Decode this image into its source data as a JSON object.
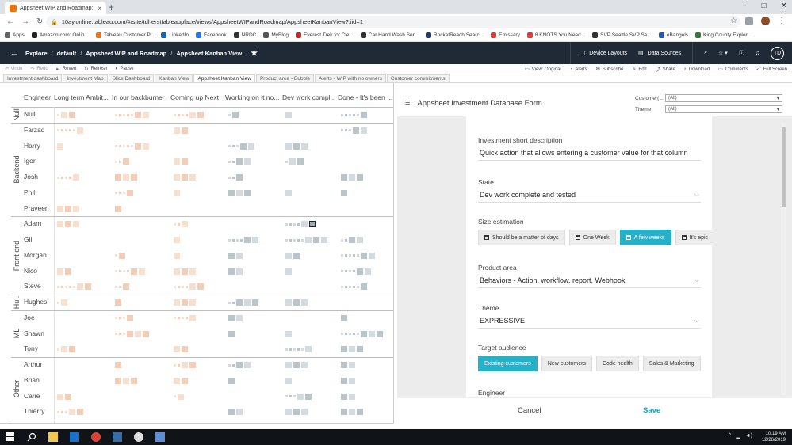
{
  "browser": {
    "tab_title": "Appsheet WIP and Roadmap: Ap",
    "tab_close": "×",
    "new_tab": "+",
    "url": "10ay.online.tableau.com/#/site/tdhersttableauplace/views/AppsheetWIPandRoadmap/AppsheetKanbanView?:iid=1",
    "window_controls": [
      "–",
      "□",
      "✕"
    ]
  },
  "bookmarks": [
    {
      "label": "Apps",
      "color": "#5f6368"
    },
    {
      "label": "Amazon.com: Onlin...",
      "color": "#222222"
    },
    {
      "label": "Tableau Customer P...",
      "color": "#e8710a"
    },
    {
      "label": "LinkedIn",
      "color": "#0a66c2"
    },
    {
      "label": "Facebook",
      "color": "#1877f2"
    },
    {
      "label": "NRDC",
      "color": "#333333"
    },
    {
      "label": "MyBlog",
      "color": "#555555"
    },
    {
      "label": "Everest Trek for Cle...",
      "color": "#c62828"
    },
    {
      "label": "Car Hand Wash Ser...",
      "color": "#333333"
    },
    {
      "label": "RocketReach Searc...",
      "color": "#1f3b73"
    },
    {
      "label": "Emissary",
      "color": "#e53935"
    },
    {
      "label": "8 KNOTS You Need...",
      "color": "#e53935"
    },
    {
      "label": "SVP Seattle SVP Se...",
      "color": "#333333"
    },
    {
      "label": "eBangels",
      "color": "#1e5bb8"
    },
    {
      "label": "King County Explor...",
      "color": "#2e7d32"
    }
  ],
  "tableau": {
    "breadcrumbs": [
      "Explore",
      "default",
      "Appsheet WIP and Roadmap",
      "Appsheet Kanban View"
    ],
    "breadcrumb_sep": "/",
    "actions": [
      "Device Layouts",
      "Data Sources"
    ],
    "user_initials": "TD"
  },
  "toolbar": {
    "left": [
      "Undo",
      "Redo",
      "Revert",
      "Refresh",
      "Pause"
    ],
    "right": [
      "View: Original",
      "Alerts",
      "Subscribe",
      "Edit",
      "Share",
      "Download",
      "Comments",
      "Full Screen"
    ]
  },
  "sheet_tabs": [
    "Investment dashboard",
    "Investment Map",
    "Slice Dashboard",
    "Kanban View",
    "Appsheet Kanban View",
    "Product area - Bubble",
    "Alerts - WIP with no owners",
    "Customer commitments"
  ],
  "active_sheet_tab": "Appsheet Kanban View",
  "kanban": {
    "engineer_header": "Engineer",
    "columns": [
      "Long term Ambit...",
      "In our backburner",
      "Coming up Next",
      "Working on it no...",
      "Dev work compl...",
      "Done - It's been ..."
    ],
    "groups": [
      {
        "name": "Null",
        "engineers": [
          "Null"
        ]
      },
      {
        "name": "Backend",
        "engineers": [
          "Farzad",
          "Harry",
          "Igor",
          "Josh",
          "Phil",
          "Praveen"
        ]
      },
      {
        "name": "Front end",
        "engineers": [
          "Adam",
          "Gil",
          "Morgan",
          "Nico",
          "Steve"
        ]
      },
      {
        "name": "Hu..",
        "engineers": [
          "Hughes"
        ]
      },
      {
        "name": "ML",
        "engineers": [
          "Joe",
          "Shawn",
          "Tony"
        ]
      },
      {
        "name": "Other",
        "engineers": [
          "Arthur",
          "Brian",
          "Carie",
          "Thierry"
        ]
      }
    ],
    "colors": {
      "beige": "#f6e1d0",
      "peach": "#f2cdb8",
      "gray": "#d3dbe0",
      "gray_dark": "#b9c4cb"
    }
  },
  "form": {
    "title": "Appsheet Investment Database Form",
    "filters": [
      {
        "label": "Customer(...",
        "value": "(All)"
      },
      {
        "label": "Theme",
        "value": "(All)"
      }
    ],
    "fields": {
      "short_desc": {
        "label": "Investment short description",
        "value": "Quick action that allows entering a customer value for that column"
      },
      "state": {
        "label": "State",
        "value": "Dev work complete and tested"
      },
      "size": {
        "label": "Size estimation",
        "options": [
          "Should be a matter of days",
          "One Week",
          "A few weeks",
          "It's epic"
        ],
        "selected": "A few weeks"
      },
      "product_area": {
        "label": "Product area",
        "value": "Behaviors - Action, workflow, report, Webhook"
      },
      "theme": {
        "label": "Theme",
        "value": "EXPRESSIVE"
      },
      "audience": {
        "label": "Target audience",
        "options": [
          "Existing customers",
          "New customers",
          "Code health",
          "Sales & Marketing"
        ],
        "selected": "Existing customers"
      },
      "engineer": {
        "label": "Engineer"
      }
    },
    "cancel_label": "Cancel",
    "save_label": "Save",
    "accent": "#26b1c9"
  },
  "taskbar": {
    "time": "10:19 AM",
    "date": "12/26/2019"
  }
}
